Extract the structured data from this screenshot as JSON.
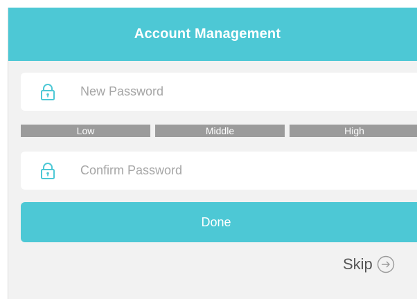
{
  "header": {
    "title": "Account Management"
  },
  "form": {
    "new_password": {
      "placeholder": "New Password",
      "value": "",
      "icon": "lock-icon"
    },
    "confirm_password": {
      "placeholder": "Confirm Password",
      "value": "",
      "icon": "lock-icon"
    },
    "strength_levels": [
      "Low",
      "Middle",
      "High"
    ],
    "done_label": "Done"
  },
  "skip": {
    "label": "Skip",
    "icon": "arrow-right-circle-icon"
  },
  "colors": {
    "accent": "#4dc8d5",
    "background": "#f2f2f2",
    "strength_bar": "#9b9b9b",
    "placeholder": "#a6a6a6"
  }
}
